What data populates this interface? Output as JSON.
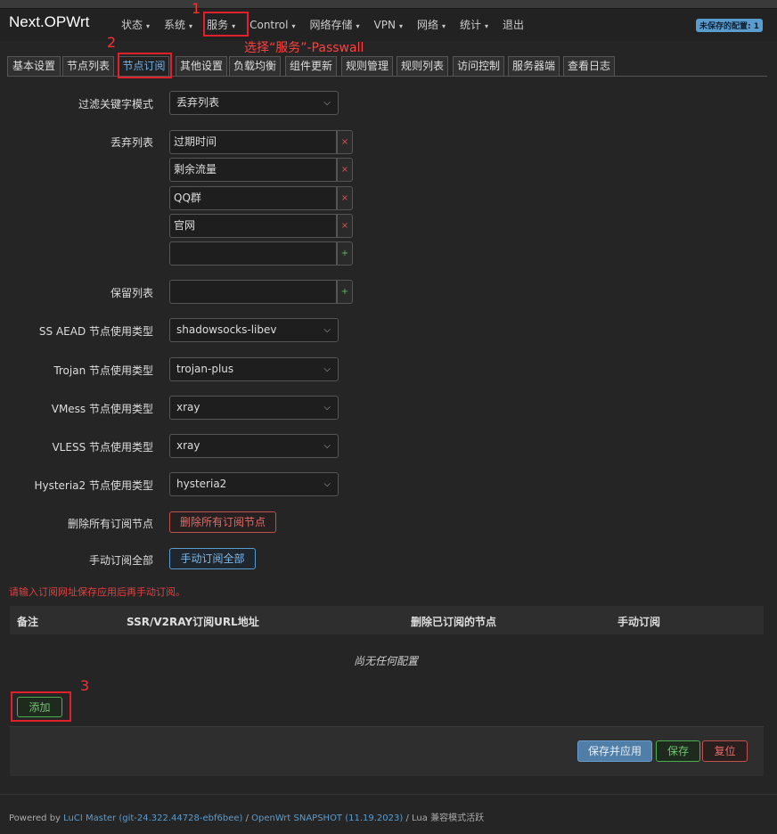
{
  "brand": "Next.OPWrt",
  "menu": [
    {
      "label": "状态",
      "caret": true
    },
    {
      "label": "系统",
      "caret": true
    },
    {
      "label": "服务",
      "caret": true
    },
    {
      "label": "Control",
      "caret": true
    },
    {
      "label": "网络存储",
      "caret": true
    },
    {
      "label": "VPN",
      "caret": true
    },
    {
      "label": "网络",
      "caret": true
    },
    {
      "label": "统计",
      "caret": true
    },
    {
      "label": "退出",
      "caret": false
    }
  ],
  "unsaved_badge": "未保存的配置: 1",
  "annotations": {
    "n1": "1",
    "n2": "2",
    "n3": "3",
    "hint": "选择“服务”-Passwall"
  },
  "tabs": [
    "基本设置",
    "节点列表",
    "节点订阅",
    "其他设置",
    "负载均衡",
    "组件更新",
    "规则管理",
    "规则列表",
    "访问控制",
    "服务器端",
    "查看日志"
  ],
  "active_tab": "节点订阅",
  "form": {
    "filter_mode": {
      "label": "过滤关键字模式",
      "value": "丢弃列表"
    },
    "discard_list": {
      "label": "丢弃列表",
      "items": [
        "过期时间",
        "剩余流量",
        "QQ群",
        "官网"
      ],
      "new_value": ""
    },
    "keep_list": {
      "label": "保留列表",
      "value": ""
    },
    "ss_aead": {
      "label": "SS AEAD 节点使用类型",
      "value": "shadowsocks-libev"
    },
    "trojan": {
      "label": "Trojan 节点使用类型",
      "value": "trojan-plus"
    },
    "vmess": {
      "label": "VMess 节点使用类型",
      "value": "xray"
    },
    "vless": {
      "label": "VLESS 节点使用类型",
      "value": "xray"
    },
    "hysteria2": {
      "label": "Hysteria2 节点使用类型",
      "value": "hysteria2"
    },
    "delete_all": {
      "label": "删除所有订阅节点",
      "button": "删除所有订阅节点"
    },
    "manual_all": {
      "label": "手动订阅全部",
      "button": "手动订阅全部"
    }
  },
  "icons": {
    "remove": "×",
    "add": "+",
    "chevron": "⌵",
    "caret": "▾"
  },
  "warning": "请输入订阅网址保存应用后再手动订阅。",
  "table": {
    "headers": [
      "备注",
      "SSR/V2RAY订阅URL地址",
      "删除已订阅的节点",
      "手动订阅"
    ],
    "empty": "尚无任何配置"
  },
  "add_button": "添加",
  "actions": {
    "save_apply": "保存并应用",
    "save": "保存",
    "reset": "复位"
  },
  "footer": {
    "prefix": "Powered by ",
    "luci": "LuCI Master (git-24.322.44728-ebf6bee)",
    "sep": " / ",
    "openwrt": "OpenWrt SNAPSHOT (11.19.2023)",
    "suffix": " / Lua 兼容模式活跃"
  },
  "colors": {
    "accent": "#5b9ccf",
    "annotation": "#e0202a",
    "danger": "#c0504d",
    "success": "#4cae4c"
  }
}
